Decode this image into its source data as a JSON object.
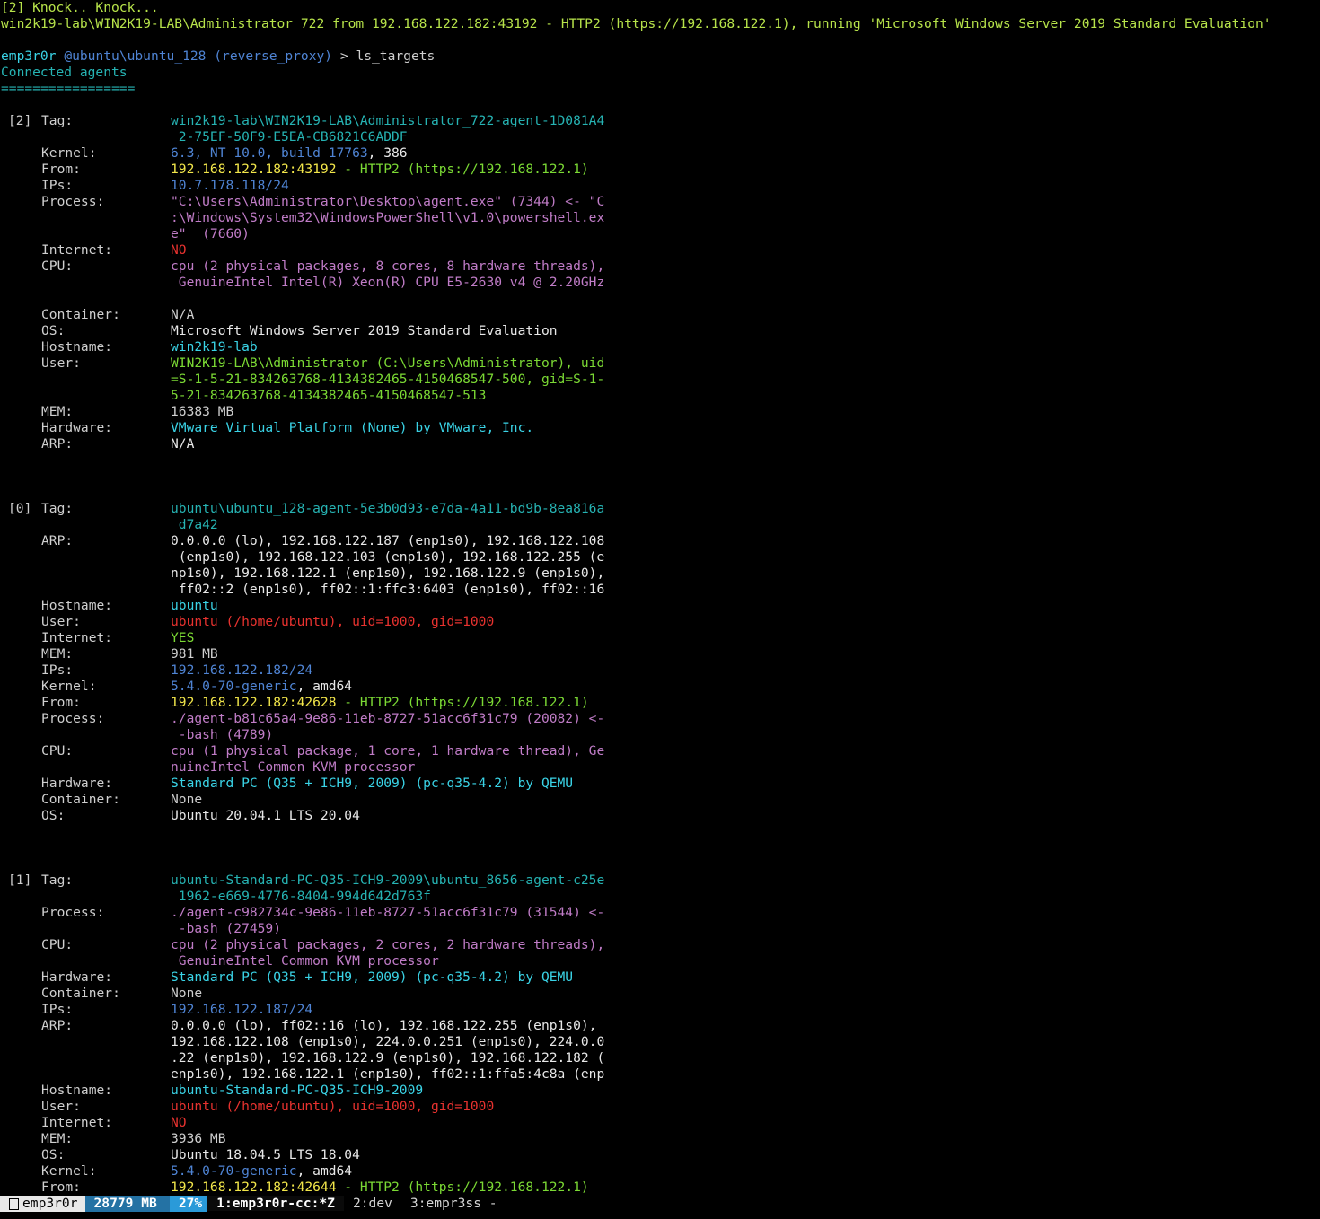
{
  "banner": {
    "knock": "[2] Knock.. Knock...",
    "connect": "win2k19-lab\\WIN2K19-LAB\\Administrator_722 from 192.168.122.182:43192 - HTTP2 (https://192.168.122.1), running 'Microsoft Windows Server 2019 Standard Evaluation'"
  },
  "prompt": {
    "user": "emp3r0r",
    "host": "@ubuntu\\ubuntu_128",
    "module": "(reverse_proxy)",
    "arrow": ">",
    "command": "ls_targets"
  },
  "heading": "Connected agents",
  "underline": "=================",
  "agents": [
    {
      "index": "[2]",
      "rows": [
        {
          "label": "Tag:",
          "lines": [
            [
              {
                "t": "win2k19-lab\\WIN2K19-LAB\\Administrator_722-agent-1D081A4",
                "c": "teal"
              }
            ],
            [
              {
                "t": " 2-75EF-50F9-E5EA-CB6821C6ADDF",
                "c": "teal"
              }
            ]
          ]
        },
        {
          "label": "Kernel:",
          "lines": [
            [
              {
                "t": "6.3, NT 10.0, build 17763",
                "c": "blue"
              },
              {
                "t": ", 386",
                "c": "white"
              }
            ]
          ]
        },
        {
          "label": "From:",
          "lines": [
            [
              {
                "t": "192.168.122.182:43192",
                "c": "yellow"
              },
              {
                "t": " - HTTP2 (https://192.168.122.1)",
                "c": "green"
              }
            ]
          ]
        },
        {
          "label": "IPs:",
          "lines": [
            [
              {
                "t": "10.7.178.118/24",
                "c": "blue"
              }
            ]
          ]
        },
        {
          "label": "Process:",
          "lines": [
            [
              {
                "t": "\"C:\\Users\\Administrator\\Desktop\\agent.exe\" (7344) <- \"C",
                "c": "purple"
              }
            ],
            [
              {
                "t": ":\\Windows\\System32\\WindowsPowerShell\\v1.0\\powershell.ex",
                "c": "purple"
              }
            ],
            [
              {
                "t": "e\"  (7660)",
                "c": "purple"
              }
            ]
          ]
        },
        {
          "label": "Internet:",
          "lines": [
            [
              {
                "t": "NO",
                "c": "red"
              }
            ]
          ]
        },
        {
          "label": "CPU:",
          "lines": [
            [
              {
                "t": "cpu (2 physical packages, 8 cores, 8 hardware threads),",
                "c": "purple"
              }
            ],
            [
              {
                "t": " GenuineIntel Intel(R) Xeon(R) CPU E5-2630 v4 @ 2.20GHz",
                "c": "purple"
              }
            ],
            [
              {
                "t": "",
                "c": "purple"
              }
            ]
          ]
        },
        {
          "label": "Container:",
          "lines": [
            [
              {
                "t": "N/A",
                "c": "grey"
              }
            ]
          ]
        },
        {
          "label": "OS:",
          "lines": [
            [
              {
                "t": "Microsoft Windows Server 2019 Standard Evaluation",
                "c": "white"
              }
            ]
          ]
        },
        {
          "label": "Hostname:",
          "lines": [
            [
              {
                "t": "win2k19-lab",
                "c": "cyan"
              }
            ]
          ]
        },
        {
          "label": "User:",
          "lines": [
            [
              {
                "t": "WIN2K19-LAB\\Administrator (C:\\Users\\Administrator), uid",
                "c": "green"
              }
            ],
            [
              {
                "t": "=S-1-5-21-834263768-4134382465-4150468547-500, gid=S-1-",
                "c": "green"
              }
            ],
            [
              {
                "t": "5-21-834263768-4134382465-4150468547-513",
                "c": "green"
              }
            ]
          ]
        },
        {
          "label": "MEM:",
          "lines": [
            [
              {
                "t": "16383 MB",
                "c": "grey"
              }
            ]
          ]
        },
        {
          "label": "Hardware:",
          "lines": [
            [
              {
                "t": "VMware Virtual Platform (None) by VMware, Inc.",
                "c": "cyan"
              }
            ]
          ]
        },
        {
          "label": "ARP:",
          "lines": [
            [
              {
                "t": "N/A",
                "c": "white"
              }
            ]
          ]
        }
      ]
    },
    {
      "index": "[0]",
      "rows": [
        {
          "label": "Tag:",
          "lines": [
            [
              {
                "t": "ubuntu\\ubuntu_128-agent-5e3b0d93-e7da-4a11-bd9b-8ea816a",
                "c": "teal"
              }
            ],
            [
              {
                "t": " d7a42",
                "c": "teal"
              }
            ]
          ]
        },
        {
          "label": "ARP:",
          "lines": [
            [
              {
                "t": "0.0.0.0 (lo), 192.168.122.187 (enp1s0), 192.168.122.108",
                "c": "white"
              }
            ],
            [
              {
                "t": " (enp1s0), 192.168.122.103 (enp1s0), 192.168.122.255 (e",
                "c": "white"
              }
            ],
            [
              {
                "t": "np1s0), 192.168.122.1 (enp1s0), 192.168.122.9 (enp1s0),",
                "c": "white"
              }
            ],
            [
              {
                "t": " ff02::2 (enp1s0), ff02::1:ffc3:6403 (enp1s0), ff02::16",
                "c": "white"
              }
            ]
          ]
        },
        {
          "label": "Hostname:",
          "lines": [
            [
              {
                "t": "ubuntu",
                "c": "cyan"
              }
            ]
          ]
        },
        {
          "label": "User:",
          "lines": [
            [
              {
                "t": "ubuntu (/home/ubuntu), uid=1000, gid=1000",
                "c": "red"
              }
            ]
          ]
        },
        {
          "label": "Internet:",
          "lines": [
            [
              {
                "t": "YES",
                "c": "green"
              }
            ]
          ]
        },
        {
          "label": "MEM:",
          "lines": [
            [
              {
                "t": "981 MB",
                "c": "grey"
              }
            ]
          ]
        },
        {
          "label": "IPs:",
          "lines": [
            [
              {
                "t": "192.168.122.182/24",
                "c": "blue"
              }
            ]
          ]
        },
        {
          "label": "Kernel:",
          "lines": [
            [
              {
                "t": "5.4.0-70-generic",
                "c": "blue"
              },
              {
                "t": ", amd64",
                "c": "white"
              }
            ]
          ]
        },
        {
          "label": "From:",
          "lines": [
            [
              {
                "t": "192.168.122.182:42628",
                "c": "yellow"
              },
              {
                "t": " - HTTP2 (https://192.168.122.1)",
                "c": "green"
              }
            ]
          ]
        },
        {
          "label": "Process:",
          "lines": [
            [
              {
                "t": "./agent-b81c65a4-9e86-11eb-8727-51acc6f31c79 (20082) <-",
                "c": "purple"
              }
            ],
            [
              {
                "t": " -bash (4789)",
                "c": "purple"
              }
            ]
          ]
        },
        {
          "label": "CPU:",
          "lines": [
            [
              {
                "t": "cpu (1 physical package, 1 core, 1 hardware thread), Ge",
                "c": "purple"
              }
            ],
            [
              {
                "t": "nuineIntel Common KVM processor",
                "c": "purple"
              }
            ]
          ]
        },
        {
          "label": "Hardware:",
          "lines": [
            [
              {
                "t": "Standard PC (Q35 + ICH9, 2009) (pc-q35-4.2) by QEMU",
                "c": "cyan"
              }
            ]
          ]
        },
        {
          "label": "Container:",
          "lines": [
            [
              {
                "t": "None",
                "c": "grey"
              }
            ]
          ]
        },
        {
          "label": "OS:",
          "lines": [
            [
              {
                "t": "Ubuntu 20.04.1 LTS 20.04",
                "c": "white"
              }
            ]
          ]
        }
      ]
    },
    {
      "index": "[1]",
      "rows": [
        {
          "label": "Tag:",
          "lines": [
            [
              {
                "t": "ubuntu-Standard-PC-Q35-ICH9-2009\\ubuntu_8656-agent-c25e",
                "c": "teal"
              }
            ],
            [
              {
                "t": " 1962-e669-4776-8404-994d642d763f",
                "c": "teal"
              }
            ]
          ]
        },
        {
          "label": "Process:",
          "lines": [
            [
              {
                "t": "./agent-c982734c-9e86-11eb-8727-51acc6f31c79 (31544) <-",
                "c": "purple"
              }
            ],
            [
              {
                "t": " -bash (27459)",
                "c": "purple"
              }
            ]
          ]
        },
        {
          "label": "CPU:",
          "lines": [
            [
              {
                "t": "cpu (2 physical packages, 2 cores, 2 hardware threads),",
                "c": "purple"
              }
            ],
            [
              {
                "t": " GenuineIntel Common KVM processor",
                "c": "purple"
              }
            ]
          ]
        },
        {
          "label": "Hardware:",
          "lines": [
            [
              {
                "t": "Standard PC (Q35 + ICH9, 2009) (pc-q35-4.2) by QEMU",
                "c": "cyan"
              }
            ]
          ]
        },
        {
          "label": "Container:",
          "lines": [
            [
              {
                "t": "None",
                "c": "grey"
              }
            ]
          ]
        },
        {
          "label": "IPs:",
          "lines": [
            [
              {
                "t": "192.168.122.187/24",
                "c": "blue"
              }
            ]
          ]
        },
        {
          "label": "ARP:",
          "lines": [
            [
              {
                "t": "0.0.0.0 (lo), ff02::16 (lo), 192.168.122.255 (enp1s0),",
                "c": "white"
              }
            ],
            [
              {
                "t": "192.168.122.108 (enp1s0), 224.0.0.251 (enp1s0), 224.0.0",
                "c": "white"
              }
            ],
            [
              {
                "t": ".22 (enp1s0), 192.168.122.9 (enp1s0), 192.168.122.182 (",
                "c": "white"
              }
            ],
            [
              {
                "t": "enp1s0), 192.168.122.1 (enp1s0), ff02::1:ffa5:4c8a (enp",
                "c": "white"
              }
            ]
          ]
        },
        {
          "label": "Hostname:",
          "lines": [
            [
              {
                "t": "ubuntu-Standard-PC-Q35-ICH9-2009",
                "c": "cyan"
              }
            ]
          ]
        },
        {
          "label": "User:",
          "lines": [
            [
              {
                "t": "ubuntu (/home/ubuntu), uid=1000, gid=1000",
                "c": "red"
              }
            ]
          ]
        },
        {
          "label": "Internet:",
          "lines": [
            [
              {
                "t": "NO",
                "c": "red"
              }
            ]
          ]
        },
        {
          "label": "MEM:",
          "lines": [
            [
              {
                "t": "3936 MB",
                "c": "grey"
              }
            ]
          ]
        },
        {
          "label": "OS:",
          "lines": [
            [
              {
                "t": "Ubuntu 18.04.5 LTS 18.04",
                "c": "white"
              }
            ]
          ]
        },
        {
          "label": "Kernel:",
          "lines": [
            [
              {
                "t": "5.4.0-70-generic",
                "c": "blue"
              },
              {
                "t": ", amd64",
                "c": "white"
              }
            ]
          ]
        },
        {
          "label": "From:",
          "lines": [
            [
              {
                "t": "192.168.122.182:42644",
                "c": "yellow"
              },
              {
                "t": " - HTTP2 (https://192.168.122.1)",
                "c": "green"
              }
            ]
          ]
        }
      ]
    }
  ],
  "statusbar": {
    "user": "emp3r0r",
    "mem": "28779 MB",
    "cpu": "27%",
    "windows": [
      {
        "label": "1:emp3r0r-cc:*Z",
        "active": true
      },
      {
        "label": "2:dev",
        "active": false
      },
      {
        "label": "3:empr3ss -",
        "active": false
      }
    ]
  }
}
